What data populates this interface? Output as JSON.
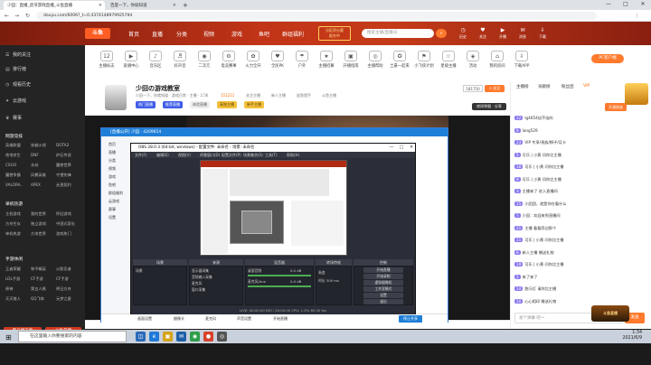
{
  "browser": {
    "tabs": [
      {
        "label": "少囧：直播_虎牙游戏直播_斗鱼直播",
        "active": true
      },
      {
        "label": "百度一下，你就知道",
        "active": false
      }
    ],
    "new_tab": "+",
    "url": "douyu.com/6006?_t=0.4374148979925794",
    "controls": {
      "minimize": "—",
      "maximize": "□",
      "close": "✕"
    }
  },
  "header": {
    "logo": "斗鱼",
    "nav": [
      "首页",
      "直播",
      "分类",
      "视频",
      "游戏",
      "鱼吧",
      "群组福利"
    ],
    "promo_line1": "分区积分赛",
    "promo_line2": "报名中",
    "search_placeholder": "搜索主播/直播间",
    "icons": [
      "历史",
      "关注",
      "开播",
      "消息",
      "下载"
    ]
  },
  "sidebar": {
    "items": [
      {
        "icon": "☰",
        "label": "我的关注"
      },
      {
        "icon": "▤",
        "label": "排行榜"
      },
      {
        "icon": "◷",
        "label": "观看历史"
      },
      {
        "icon": "✦",
        "label": "云游戏"
      },
      {
        "icon": "♛",
        "label": "赛事"
      }
    ],
    "sections": [
      "网游竞技",
      "单机热游",
      "手游休闲"
    ],
    "grid1": [
      "英雄联盟",
      "穿越火线",
      "DOTA2",
      "绝地求生",
      "DNF",
      "炉石传说",
      "CSGO",
      "永劫",
      "魔兽世界",
      "魔兽争霸",
      "风暴英雄",
      "守望先锋",
      "VALORA..",
      "APEX",
      "无畏契约"
    ],
    "grid2": [
      "主机游戏",
      "我的世界",
      "怀旧游戏",
      "方舟生存",
      "独立游戏",
      "中国式家长",
      "单机热游",
      "方块世界",
      "游戏热门"
    ],
    "grid3": [
      "王者荣耀",
      "和平精英",
      "火影忍者",
      "LOL手游",
      "CF手游",
      "CF手游",
      "原神",
      "第五人格",
      "明日方舟",
      "天天狼人",
      "QQ飞车",
      "元梦之星"
    ],
    "buttons": [
      "客户端下载",
      "斗鱼开播"
    ]
  },
  "categories": [
    {
      "icon": "12",
      "label": "主播标志"
    },
    {
      "icon": "▶",
      "label": "直播中心"
    },
    {
      "icon": "♪",
      "label": "音乐区"
    },
    {
      "icon": "♬",
      "label": "好声音"
    },
    {
      "icon": "◉",
      "label": "二次元"
    },
    {
      "icon": "⚙",
      "label": "电竞赛事"
    },
    {
      "icon": "✿",
      "label": "火力全开"
    },
    {
      "icon": "♥",
      "label": "全民PK"
    },
    {
      "icon": "☂",
      "label": "户外"
    },
    {
      "icon": "★",
      "label": "主播招募"
    },
    {
      "icon": "▣",
      "label": "开播指南"
    },
    {
      "icon": "◎",
      "label": "主播帮助"
    },
    {
      "icon": "✪",
      "label": "土豪一起来"
    },
    {
      "icon": "⚑",
      "label": "小飞侠计划"
    },
    {
      "icon": "☆",
      "label": "星级主播"
    },
    {
      "icon": "◈",
      "label": "活动"
    },
    {
      "icon": "⌂",
      "label": "我的房间"
    },
    {
      "icon": "⇩",
      "label": "下载APP"
    }
  ],
  "pc_button": "PC客户端",
  "room": {
    "title": "少囧の游戏教室",
    "info": [
      "少囧一下，你就知道 · 游戏日常 · 主播 · 2.5K",
      "151211",
      "关注主播",
      "新人主播",
      "鲨鱼猎手",
      "斗鱼主播"
    ],
    "tags": [
      "热门直播",
      "推荐直播",
      "体验直播",
      "高效主播",
      "新手主播"
    ],
    "follow": "+ 关注",
    "fans": "181750",
    "report": "房间举报 · 分享"
  },
  "chat": {
    "tabs": [
      "主播榜",
      "贡献榜",
      "粉丝团",
      "VIP"
    ],
    "open_button": "开通贵族",
    "lines": [
      {
        "lvl": "12",
        "text": "lg4654倍不倍的"
      },
      {
        "lvl": "8",
        "text": "lang529"
      },
      {
        "lvl": "23",
        "text": "VIP 专享/贵族/狮子/月卡"
      },
      {
        "lvl": "5",
        "text": "可乐 | 小黄 问你比主播"
      },
      {
        "lvl": "18",
        "text": "可乐 | 小黄 问你比主播"
      },
      {
        "lvl": "9",
        "text": "可乐 | 小黄 问你比主播"
      },
      {
        "lvl": "3",
        "text": "主播来了 进入直播间"
      },
      {
        "lvl": "15",
        "text": "小团团，就是你在看什么"
      },
      {
        "lvl": "7",
        "text": "少囧：欢迎来到直播间"
      },
      {
        "lvl": "21",
        "text": "主播 看看旁边那个"
      },
      {
        "lvl": "11",
        "text": "可乐 | 小黄 问你比主播"
      },
      {
        "lvl": "6",
        "text": "新人主播 赠送礼物"
      },
      {
        "lvl": "19",
        "text": "可乐 | 小黄 问你比主播"
      },
      {
        "lvl": "2",
        "text": "来了来了"
      },
      {
        "lvl": "14",
        "text": "跑马灯 请你比主播"
      },
      {
        "lvl": "10",
        "text": "心心相印 赠送礼物"
      }
    ],
    "input_placeholder": "发个弹幕 吧～",
    "send": "发送"
  },
  "share_window": {
    "title": "[直播公开] 少囧 · 4209654",
    "left_items": [
      "首页",
      "直播",
      "分类",
      "视频",
      "游戏",
      "鱼吧",
      "群组福利",
      "云游戏",
      "赛事",
      "设置"
    ],
    "bottom": [
      "画面设置",
      "摄像头",
      "麦克风",
      "声音设置",
      "开始直播"
    ],
    "stop": "停止共享"
  },
  "obs": {
    "title": "OBS 28.0.3 (64-bit, windows) - 配置文件: 未命名 - 场景: 未命名",
    "menu": [
      "文件(F)",
      "编辑(E)",
      "视图(V)",
      "停靠窗口(D)",
      "配置文件(P)",
      "场景集合(S)",
      "工具(T)",
      "帮助(H)"
    ],
    "docks": [
      "场景",
      "来源",
      "混音器",
      "转场特效",
      "控制"
    ],
    "scene": "场景",
    "sources": [
      "显示器采集",
      "音频输入采集",
      "麦克风",
      "窗口采集"
    ],
    "mixer": [
      "桌面音频",
      "0.0 dB",
      "麦克风/Aux",
      "0.0 dB"
    ],
    "transition": [
      "渐变",
      "时长 300 ms"
    ],
    "controls": [
      "开始直播",
      "开始录制",
      "虚拟摄像机",
      "工作室模式",
      "设置",
      "退出"
    ],
    "status": "LIVE: 00:00:00   REC: 00:00:00   CPU: 1.5%   60.00 fps"
  },
  "taskbar": {
    "start": "⊞",
    "search": "在这里输入你要搜索的内容",
    "apps": [
      {
        "glyph": "◫",
        "color": "#2a6ab8"
      },
      {
        "glyph": "e",
        "color": "#1f7ad8"
      },
      {
        "glyph": "▣",
        "color": "#d6a41a"
      },
      {
        "glyph": "✉",
        "color": "#1f5fa8"
      },
      {
        "glyph": "◉",
        "color": "#2e9e4a"
      },
      {
        "glyph": "●",
        "color": "#d8422c"
      },
      {
        "glyph": "◎",
        "color": "#555555"
      }
    ],
    "time": "1:34",
    "date": "2021/6/9"
  },
  "brand_badge": "斗鱼直播"
}
